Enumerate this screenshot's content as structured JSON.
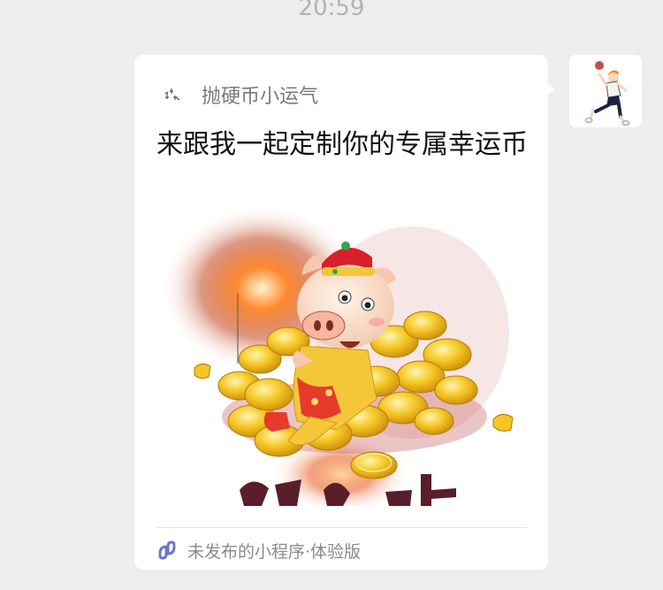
{
  "chat": {
    "timestamp": "20:59"
  },
  "message": {
    "app_name": "抛硬币小运气",
    "title": "来跟我一起定制你的专属幸运币",
    "footer_label": "未发布的小程序·体验版",
    "icons": {
      "app": "coin-logo-icon",
      "footer": "mini-program-icon",
      "avatar": "volleyball-player-avatar"
    }
  },
  "colors": {
    "background": "#ededed",
    "card": "#ffffff",
    "title": "#111111",
    "muted": "#8a8a8a",
    "mini_program_accent": "#6b75c9"
  }
}
